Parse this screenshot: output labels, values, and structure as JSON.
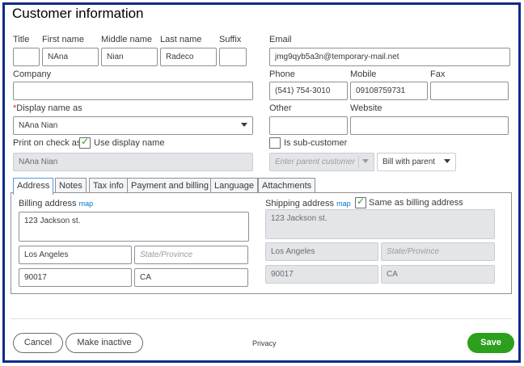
{
  "title": "Customer information",
  "labels": {
    "title": "Title",
    "first_name": "First name",
    "middle_name": "Middle name",
    "last_name": "Last name",
    "suffix": "Suffix",
    "email": "Email",
    "company": "Company",
    "phone": "Phone",
    "mobile": "Mobile",
    "fax": "Fax",
    "display_name": "Display name as",
    "other": "Other",
    "website": "Website",
    "print_on_check": "Print on check as",
    "use_display_name": "Use display name",
    "is_sub_customer": "Is sub-customer"
  },
  "values": {
    "title": "",
    "first_name": "NAna",
    "middle_name": "Nian",
    "last_name": "Radeco",
    "suffix": "",
    "email": "jmg9qyb5a3n@temporary-mail.net",
    "company": "",
    "phone": "(541) 754-3010",
    "mobile": "09108759731",
    "fax": "",
    "display_name": "NAna Nian",
    "other": "",
    "website": "",
    "print_on_check": "NAna Nian",
    "parent_customer_placeholder": "Enter parent customer",
    "bill_with": "Bill with parent"
  },
  "tabs": [
    "Address",
    "Notes",
    "Tax info",
    "Payment and billing",
    "Language",
    "Attachments"
  ],
  "billing": {
    "label": "Billing address",
    "map": "map",
    "street": "123 Jackson st.",
    "city": "Los Angeles",
    "state_placeholder": "State/Province",
    "zip": "90017",
    "country": "CA"
  },
  "shipping": {
    "label": "Shipping address",
    "map": "map",
    "same_as_billing": "Same as billing address",
    "street": "123 Jackson st.",
    "city": "Los Angeles",
    "state_placeholder": "State/Province",
    "zip": "90017",
    "country": "CA"
  },
  "footer": {
    "cancel": "Cancel",
    "make_inactive": "Make inactive",
    "privacy": "Privacy",
    "save": "Save"
  },
  "colors": {
    "accent": "#2ca01c",
    "frame": "#0d2a8c",
    "link": "#0077c5",
    "required": "#d52b1e"
  }
}
